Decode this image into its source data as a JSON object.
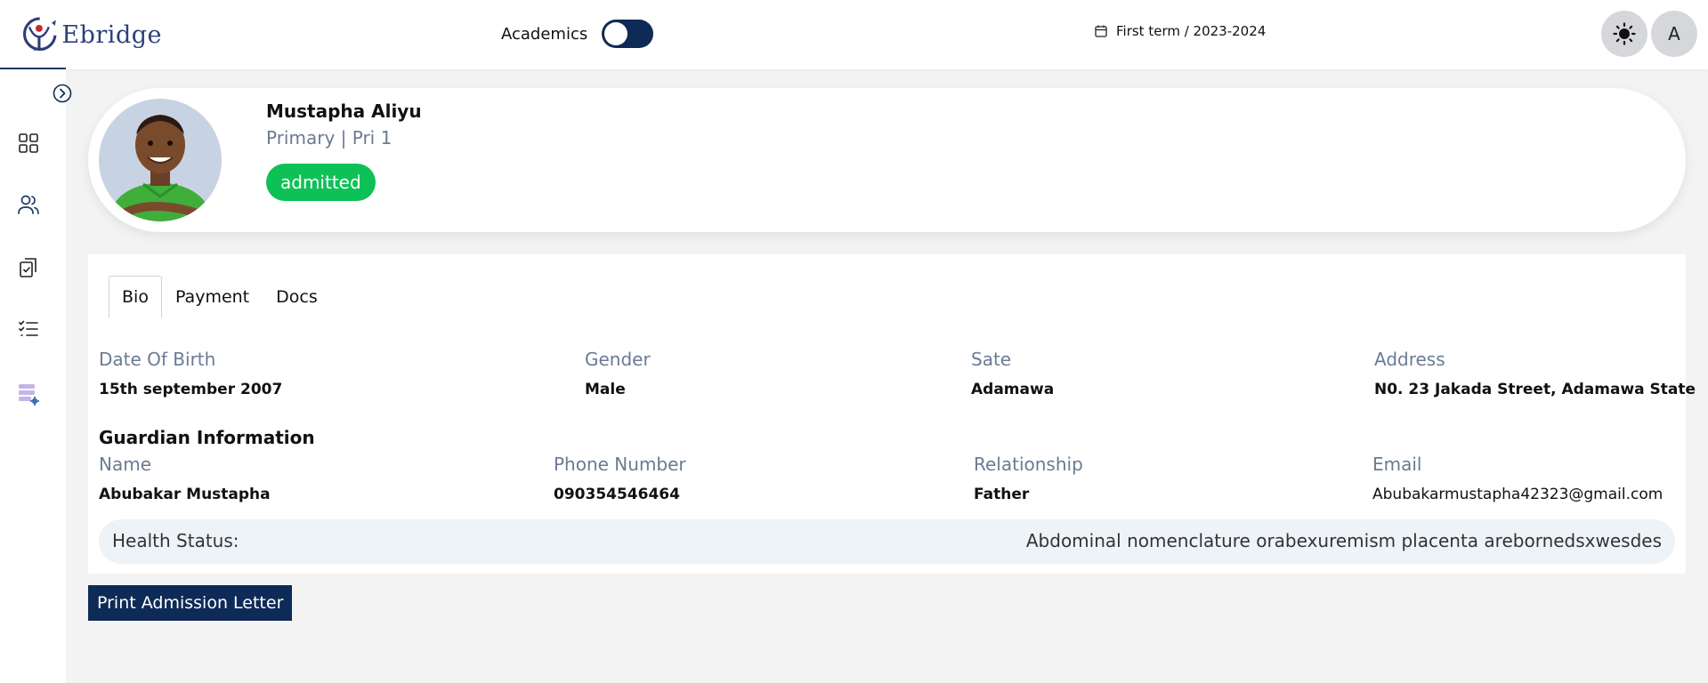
{
  "brand": {
    "name": "Ebridge",
    "accent": "#0e2a56"
  },
  "header": {
    "academics_label": "Academics",
    "academics_toggle": "off",
    "term": "First term / 2023-2024",
    "theme_icon": "sun-icon",
    "avatar_initial": "A"
  },
  "sidebar": {
    "collapse_icon": "chevron-right-circle-icon",
    "items": [
      {
        "icon": "dashboard-grid-icon"
      },
      {
        "icon": "users-icon"
      },
      {
        "icon": "clipboard-check-icon"
      },
      {
        "icon": "checklist-icon"
      },
      {
        "icon": "database-settings-icon"
      }
    ]
  },
  "profile": {
    "name": "Mustapha Aliyu",
    "class": "Primary | Pri 1",
    "status": "admitted",
    "status_color": "#0dc157"
  },
  "tabs": [
    {
      "label": "Bio",
      "active": true
    },
    {
      "label": "Payment",
      "active": false
    },
    {
      "label": "Docs",
      "active": false
    }
  ],
  "bio": {
    "dob_label": "Date Of Birth",
    "dob": "15th september 2007",
    "gender_label": "Gender",
    "gender": "Male",
    "state_label": "Sate",
    "state": "Adamawa",
    "address_label": "Address",
    "address": "N0. 23 Jakada Street, Adamawa State"
  },
  "guardian": {
    "title": "Guardian Information",
    "name_label": "Name",
    "name": "Abubakar Mustapha",
    "phone_label": "Phone Number",
    "phone": "090354546464",
    "relationship_label": "Relationship",
    "relationship": "Father",
    "email_label": "Email",
    "email": "Abubakarmustapha42323@gmail.com"
  },
  "health": {
    "label": "Health Status:",
    "value": "Abdominal nomenclature orabexuremism placenta arebornedsxwesdes"
  },
  "actions": {
    "print_label": "Print Admission Letter"
  }
}
